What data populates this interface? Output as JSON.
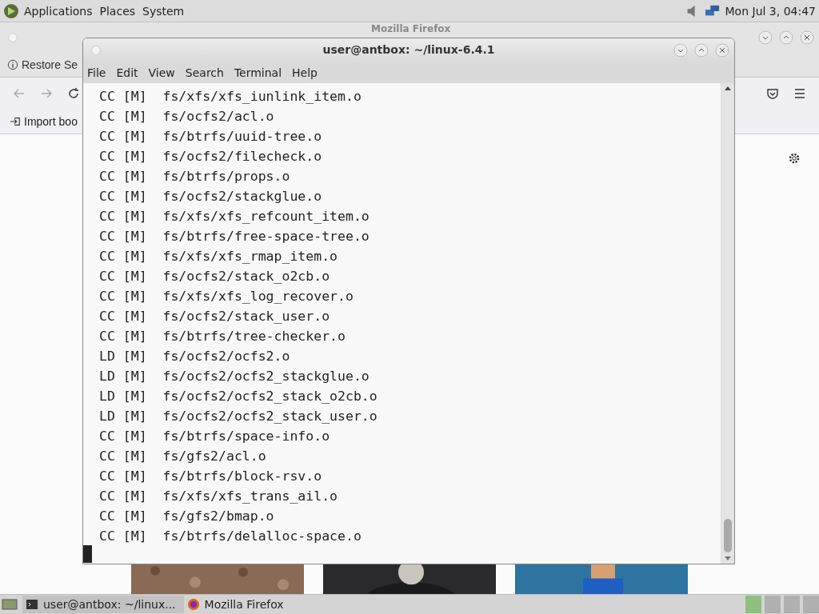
{
  "top_panel": {
    "menus": [
      "Applications",
      "Places",
      "System"
    ],
    "clock": "Mon Jul 3, 04:47"
  },
  "firefox": {
    "title": "Mozilla Firefox",
    "restore_session": "Restore Se",
    "import_bookmarks": "Import boo"
  },
  "terminal": {
    "title": "user@antbox: ~/linux-6.4.1",
    "menu": [
      "File",
      "Edit",
      "View",
      "Search",
      "Terminal",
      "Help"
    ],
    "lines": [
      "CC [M]  fs/xfs/xfs_iunlink_item.o",
      "CC [M]  fs/ocfs2/acl.o",
      "CC [M]  fs/btrfs/uuid-tree.o",
      "CC [M]  fs/ocfs2/filecheck.o",
      "CC [M]  fs/btrfs/props.o",
      "CC [M]  fs/ocfs2/stackglue.o",
      "CC [M]  fs/xfs/xfs_refcount_item.o",
      "CC [M]  fs/btrfs/free-space-tree.o",
      "CC [M]  fs/xfs/xfs_rmap_item.o",
      "CC [M]  fs/ocfs2/stack_o2cb.o",
      "CC [M]  fs/xfs/xfs_log_recover.o",
      "CC [M]  fs/ocfs2/stack_user.o",
      "CC [M]  fs/btrfs/tree-checker.o",
      "LD [M]  fs/ocfs2/ocfs2.o",
      "LD [M]  fs/ocfs2/ocfs2_stackglue.o",
      "LD [M]  fs/ocfs2/ocfs2_stack_o2cb.o",
      "LD [M]  fs/ocfs2/ocfs2_stack_user.o",
      "CC [M]  fs/btrfs/space-info.o",
      "CC [M]  fs/gfs2/acl.o",
      "CC [M]  fs/btrfs/block-rsv.o",
      "CC [M]  fs/xfs/xfs_trans_ail.o",
      "CC [M]  fs/gfs2/bmap.o",
      "CC [M]  fs/btrfs/delalloc-space.o"
    ]
  },
  "taskbar": {
    "tasks": [
      {
        "label": "user@antbox: ~/linux...",
        "kind": "terminal",
        "selected": true
      },
      {
        "label": "Mozilla Firefox",
        "kind": "firefox",
        "selected": false
      }
    ]
  }
}
